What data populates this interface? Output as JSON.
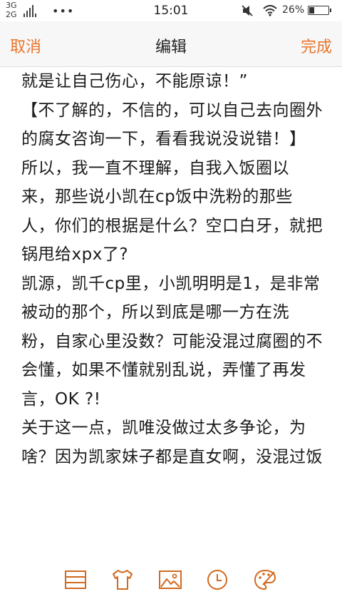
{
  "status_bar": {
    "network_top": "3G",
    "network_bottom": "2G",
    "notification_dots": "•••",
    "time": "15:01",
    "battery_percent": "26%",
    "battery_level": 0.26,
    "icons": [
      "signal-icon",
      "mute-icon",
      "wifi-icon",
      "battery-icon"
    ]
  },
  "nav": {
    "cancel_label": "取消",
    "title": "编辑",
    "done_label": "完成",
    "accent_color": "#e8762c"
  },
  "editor": {
    "lines": [
      "就是让自己伤心，不能原谅！”",
      "【不了解的，不信的，可以自己去向圈外",
      "的腐女咨询一下，看看我说没说错！】",
      "所以，我一直不理解，自我入饭圈以",
      "来，那些说小凯在cp饭中洗粉的那些",
      "人，你们的根据是什么？空口白牙，就把",
      "锅甩给xpx了?",
      "凯源，凯千cp里，小凯明明是1，是非常",
      "被动的那个，所以到底是哪一方在洗",
      "粉，自家心里没数？可能没混过腐圈的不",
      "会懂，如果不懂就别乱说，弄懂了再发",
      "言，OK ?!",
      "关于这一点，凯唯没做过太多争论，为",
      "啥？因为凯家妹子都是直女啊，没混过饭"
    ]
  },
  "toolbar": {
    "items": [
      "list-format-icon",
      "tshirt-theme-icon",
      "image-icon",
      "clock-icon",
      "palette-icon"
    ],
    "icon_color": "#e8762c"
  }
}
